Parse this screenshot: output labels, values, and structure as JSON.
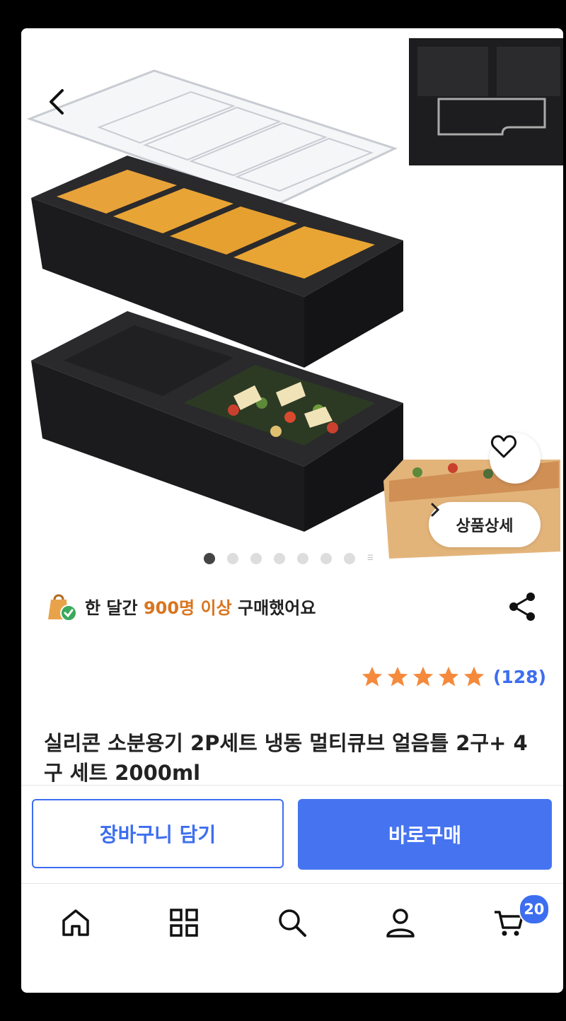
{
  "hero": {
    "detail_label": "상품상세",
    "dots_total": 7,
    "dots_active_index": 0
  },
  "purchase_info": {
    "prefix": "한 달간 ",
    "highlight": "900명 이상",
    "suffix": " 구매했어요"
  },
  "rating": {
    "stars": 5,
    "count_text": "(128)",
    "star_color": "#f58a3c"
  },
  "product": {
    "title": "실리콘 소분용기 2P세트 냉동 멀티큐브 얼음틀 2구+ 4구 세트 2000ml"
  },
  "actions": {
    "cart_label": "장바구니 담기",
    "buy_label": "바로구매"
  },
  "tabbar": {
    "items": [
      "home-icon",
      "category-grid-icon",
      "search-icon",
      "user-icon",
      "cart-icon"
    ],
    "cart_badge": "20"
  },
  "colors": {
    "accent": "#3d6ef0",
    "highlight": "#d9751f"
  }
}
